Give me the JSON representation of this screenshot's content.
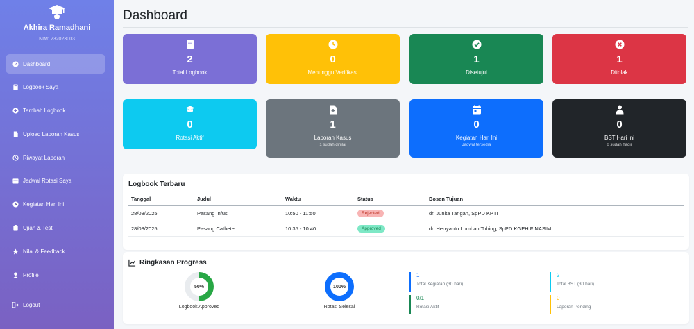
{
  "user": {
    "name": "Akhira Ramadhani",
    "nim": "NIM: 232023003"
  },
  "nav": [
    {
      "label": "Dashboard",
      "icon": "dashboard-icon",
      "active": true
    },
    {
      "label": "Logbook Saya",
      "icon": "book-icon"
    },
    {
      "label": "Tambah Logbook",
      "icon": "plus-circle-icon"
    },
    {
      "label": "Upload Laporan Kasus",
      "icon": "file-upload-icon"
    },
    {
      "label": "Riwayat Laporan",
      "icon": "history-icon"
    },
    {
      "label": "Jadwal Rotasi Saya",
      "icon": "calendar-icon"
    },
    {
      "label": "Kegiatan Hari Ini",
      "icon": "clock-icon"
    },
    {
      "label": "Ujian & Test",
      "icon": "clipboard-icon"
    },
    {
      "label": "Nilai & Feedback",
      "icon": "star-icon"
    },
    {
      "label": "Profile",
      "icon": "user-icon"
    }
  ],
  "logout_label": "Logout",
  "page_title": "Dashboard",
  "cards": [
    {
      "value": "2",
      "label": "Total Logbook",
      "sub": "",
      "color": "#7b6fd6",
      "icon": "book-icon"
    },
    {
      "value": "0",
      "label": "Menunggu Verifikasi",
      "sub": "",
      "color": "#ffc107",
      "icon": "clock-icon"
    },
    {
      "value": "1",
      "label": "Disetujui",
      "sub": "",
      "color": "#198754",
      "icon": "check-circle-icon"
    },
    {
      "value": "1",
      "label": "Ditolak",
      "sub": "",
      "color": "#dc3545",
      "icon": "x-circle-icon"
    },
    {
      "value": "0",
      "label": "Rotasi Aktif",
      "sub": "",
      "color": "#0dcaf0",
      "icon": "graduation-cap-icon"
    },
    {
      "value": "1",
      "label": "Laporan Kasus",
      "sub": "1 sudah dinilai",
      "color": "#6c757d",
      "icon": "file-medical-icon"
    },
    {
      "value": "0",
      "label": "Kegiatan Hari Ini",
      "sub": "Jadwal tersedia",
      "color": "#0d6efd",
      "icon": "calendar-day-icon"
    },
    {
      "value": "0",
      "label": "BST Hari Ini",
      "sub": "0 sudah hadir",
      "color": "#212529",
      "icon": "doctor-icon"
    }
  ],
  "logbook": {
    "title": "Logbook Terbaru",
    "headers": [
      "Tanggal",
      "Judul",
      "Waktu",
      "Status",
      "Dosen Tujuan"
    ],
    "rows": [
      {
        "tanggal": "28/08/2025",
        "judul": "Pasang Infus",
        "waktu": "10:50 - 11:50",
        "status": "Rejected",
        "dosen": "dr. Junita Tarigan, SpPD KPTI"
      },
      {
        "tanggal": "28/08/2025",
        "judul": "Pasang Catheter",
        "waktu": "10:35 - 10:40",
        "status": "Approved",
        "dosen": "dr. Herryanto Lumban Tobing, SpPD KGEH FINASIM"
      }
    ]
  },
  "progress": {
    "title": "Ringkasan Progress",
    "donuts": [
      {
        "pct_text": "50%",
        "fraction": 0.5,
        "label": "Logbook Approved",
        "color": "#28a745"
      },
      {
        "pct_text": "100%",
        "fraction": 1.0,
        "label": "Rotasi Selesai",
        "color": "#0d6efd"
      }
    ],
    "stats": [
      {
        "value": "1",
        "label": "Total Kegiatan (30 hari)",
        "color": "#0d6efd"
      },
      {
        "value": "2",
        "label": "Total BST (30 hari)",
        "color": "#0dcaf0"
      },
      {
        "value": "0/1",
        "label": "Rotasi Aktif",
        "color": "#198754"
      },
      {
        "value": "0",
        "label": "Laporan Pending",
        "color": "#ffc107"
      }
    ]
  }
}
